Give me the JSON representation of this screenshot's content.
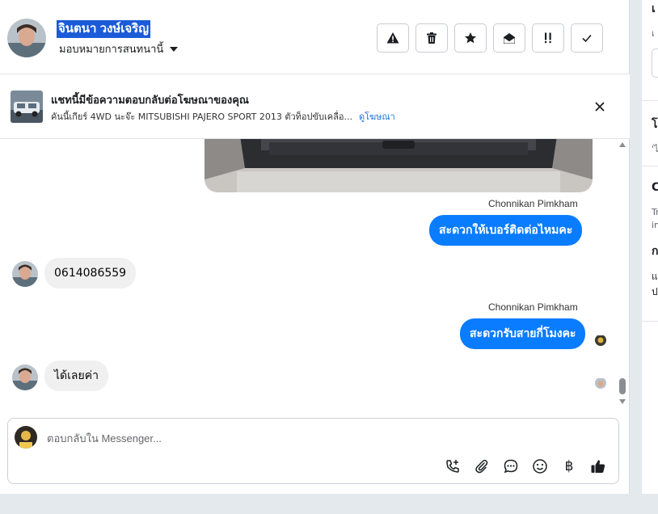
{
  "header": {
    "contact_name": "จินตนา วงษ์เจริญ",
    "assign_label": "มอบหมายการสนทนานี้",
    "actions": [
      {
        "icon": "warning-icon"
      },
      {
        "icon": "trash-icon"
      },
      {
        "icon": "star-icon"
      },
      {
        "icon": "envelope-open-icon"
      },
      {
        "icon": "priority-icon"
      },
      {
        "icon": "check-icon"
      }
    ]
  },
  "ad_banner": {
    "title": "แชทนี้มีข้อความตอบกลับต่อโฆษณาของคุณ",
    "subtitle": "คันนี้เกียร์ 4WD นะจ๊ะ MITSUBISHI PAJERO SPORT 2013 ตัวท็อปขับเคลื่อ...",
    "link_label": "ดูโฆษณา"
  },
  "messages": [
    {
      "type": "photo",
      "direction": "out"
    },
    {
      "type": "sender",
      "text": "Chonnikan Pimkham"
    },
    {
      "type": "text",
      "direction": "out",
      "text": "สะดวกให้เบอร์ติดต่อไหมคะ"
    },
    {
      "type": "text",
      "direction": "in",
      "text": "0614086559"
    },
    {
      "type": "sender",
      "text": "Chonnikan Pimkham"
    },
    {
      "type": "text",
      "direction": "out",
      "text": "สะดวกรับสายกี่โมงคะ"
    },
    {
      "type": "text",
      "direction": "in",
      "text": "ได้เลยค่า"
    }
  ],
  "composer": {
    "placeholder": "ตอบกลับใน Messenger...",
    "tools": [
      "call-plus-icon",
      "paperclip-icon",
      "chat-bubble-icon",
      "smiley-icon",
      "baht-icon",
      "thumbs-up-icon"
    ],
    "baht_symbol": "฿"
  },
  "right_panel": {
    "heading_1": "เ",
    "label_1": "เ",
    "heading_2": "โ",
    "label_2": "'ไ",
    "heading_3": "C",
    "label_3a": "Tr",
    "label_3b": "in",
    "heading_4": "ก",
    "label_4a": "แ",
    "label_4b": "ป"
  },
  "colors": {
    "accent": "#0a7cff",
    "link": "#1b74e4",
    "name_highlight": "#1c5bd8",
    "incoming_bubble": "#f0f0f0"
  }
}
